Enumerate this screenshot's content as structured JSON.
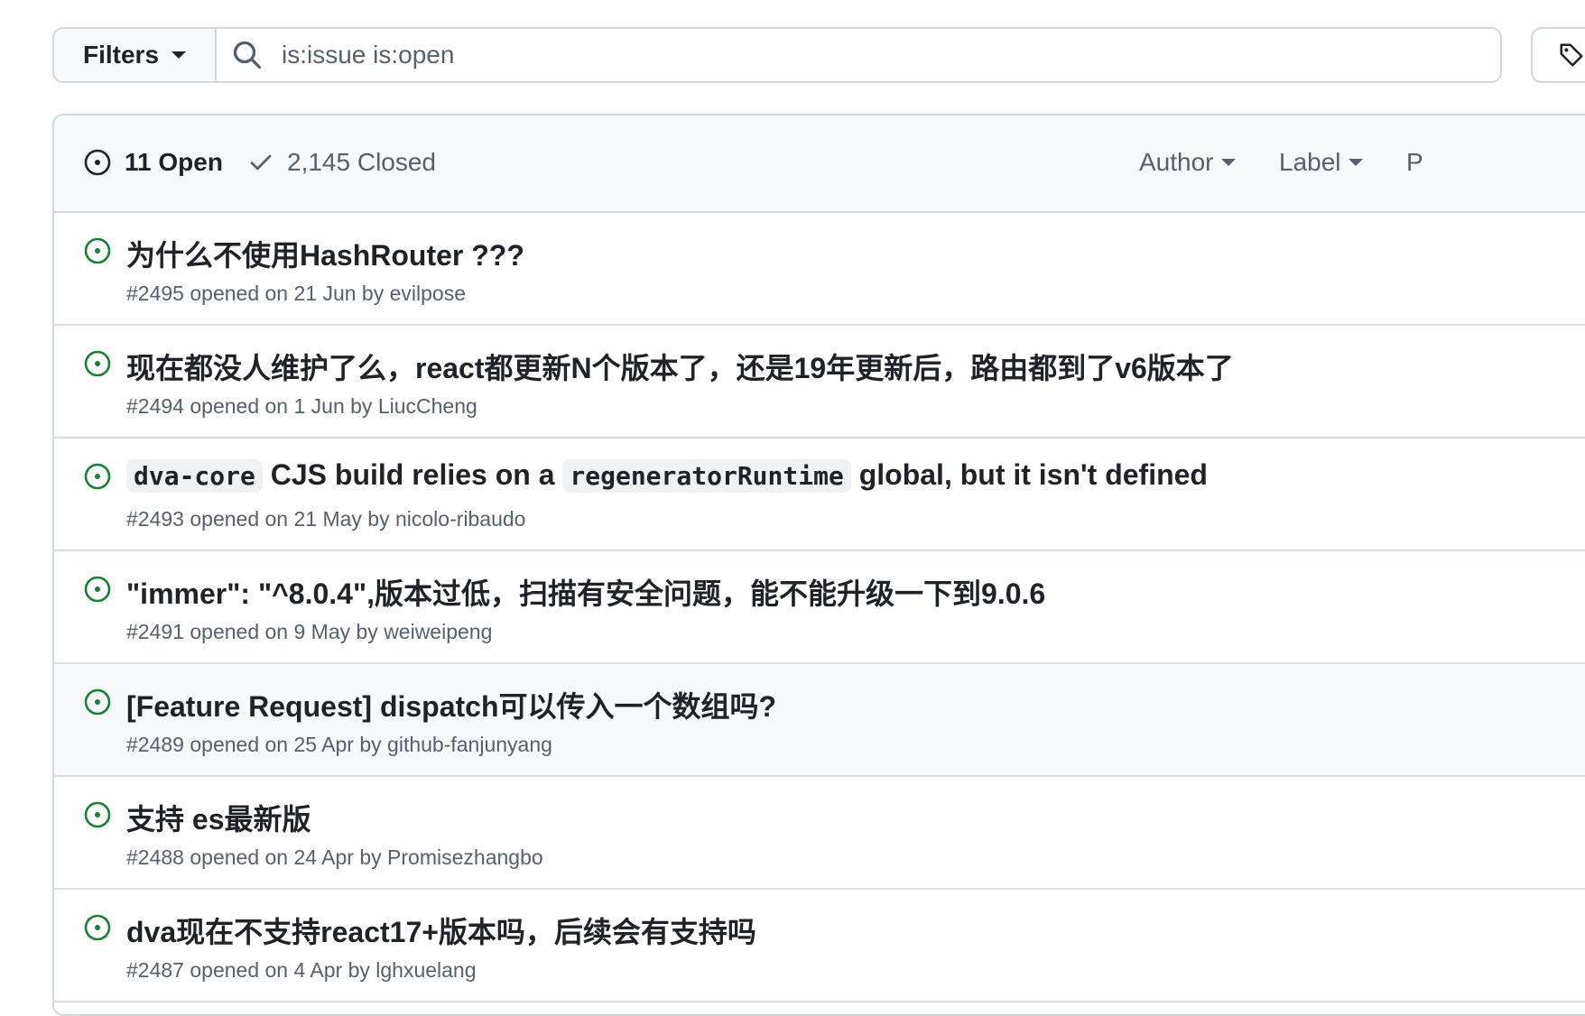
{
  "filter_bar": {
    "filters_label": "Filters",
    "search_value": "is:issue is:open"
  },
  "header": {
    "open_label": "11 Open",
    "closed_label": "2,145 Closed",
    "author_label": "Author",
    "label_label": "Label",
    "projects_partial": "P"
  },
  "issues": [
    {
      "title": "为什么不使用HashRouter ???",
      "number": "#2495",
      "opened": "opened on 21 Jun by",
      "author": "evilpose"
    },
    {
      "title": "现在都没人维护了么，react都更新N个版本了，还是19年更新后，路由都到了v6版本了",
      "number": "#2494",
      "opened": "opened on 1 Jun by",
      "author": "LiucCheng"
    },
    {
      "title_code1": "dva-core",
      "title_text1": "CJS build relies on a",
      "title_code2": "regeneratorRuntime",
      "title_text2": "global, but it isn't defined",
      "number": "#2493",
      "opened": "opened on 21 May by",
      "author": "nicolo-ribaudo"
    },
    {
      "title": "\"immer\": \"^8.0.4\",版本过低，扫描有安全问题，能不能升级一下到9.0.6",
      "number": "#2491",
      "opened": "opened on 9 May by",
      "author": "weiweipeng"
    },
    {
      "title": "[Feature Request] dispatch可以传入一个数组吗?",
      "number": "#2489",
      "opened": "opened on 25 Apr by",
      "author": "github-fanjunyang"
    },
    {
      "title": "支持 es最新版",
      "number": "#2488",
      "opened": "opened on 24 Apr by",
      "author": "Promisezhangbo"
    },
    {
      "title": "dva现在不支持react17+版本吗，后续会有支持吗",
      "number": "#2487",
      "opened": "opened on 4 Apr by",
      "author": "lghxuelang"
    }
  ],
  "colors": {
    "open_green": "#1a7f37",
    "border": "#d0d7de",
    "muted": "#57606a"
  },
  "icons": [
    "search-icon",
    "tag-icon",
    "issue-opened-icon",
    "check-icon",
    "caret-down-icon"
  ]
}
